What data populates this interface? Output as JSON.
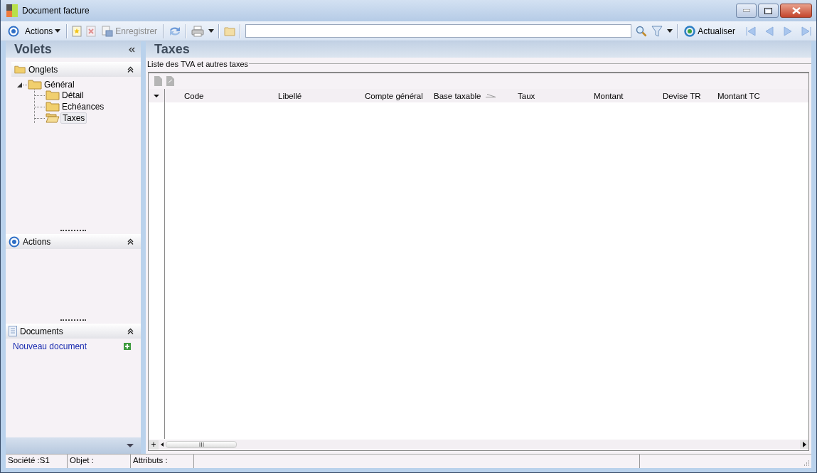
{
  "window": {
    "title": "Document facture"
  },
  "toolbar": {
    "actions_menu": "Actions",
    "save": {
      "label": "Enregistrer",
      "disabled": true
    },
    "refresh": "Actualiser"
  },
  "sidebar": {
    "title": "Volets",
    "panels": [
      {
        "kind": "tree",
        "title": "Onglets",
        "items": [
          {
            "label": "Général",
            "expanded": true,
            "selected": false,
            "children": [
              {
                "label": "Détail",
                "selected": false
              },
              {
                "label": "Echéances",
                "selected": false
              },
              {
                "label": "Taxes",
                "selected": true
              }
            ]
          }
        ]
      },
      {
        "kind": "actions",
        "title": "Actions"
      },
      {
        "kind": "documents",
        "title": "Documents",
        "links": [
          "Nouveau document"
        ]
      }
    ]
  },
  "content": {
    "title": "Taxes",
    "group": "Liste des TVA et autres taxes",
    "columns": [
      {
        "label": "Code",
        "sorted": false
      },
      {
        "label": "Libellé",
        "sorted": false
      },
      {
        "label": "Compte général",
        "sorted": false
      },
      {
        "label": "Base taxable",
        "sorted": true
      },
      {
        "label": "Taux",
        "sorted": false
      },
      {
        "label": "Montant",
        "sorted": false
      },
      {
        "label": "Devise TR",
        "sorted": false
      },
      {
        "label": "Montant TC",
        "sorted": false
      }
    ],
    "add_row": "+"
  },
  "status_bar": [
    "Société :S1",
    "Objet :",
    "Attributs :"
  ]
}
